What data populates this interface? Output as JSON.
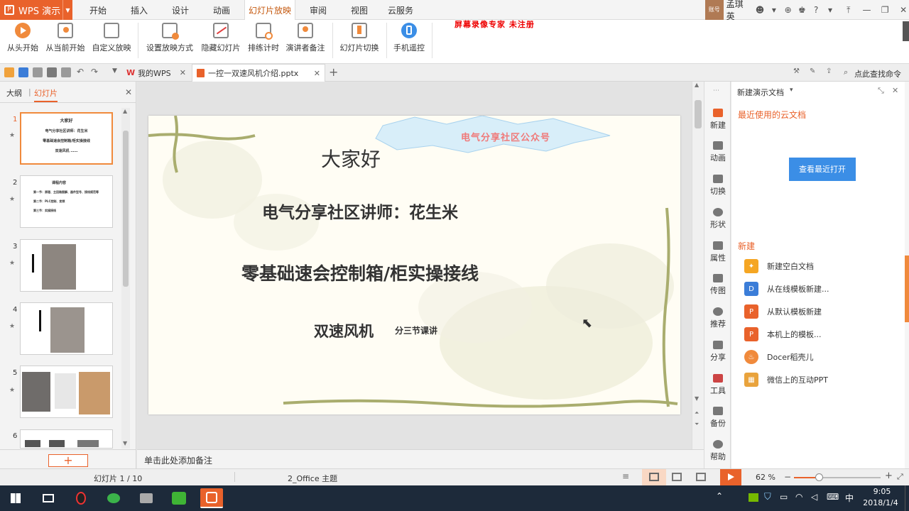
{
  "app": {
    "name": "WPS 演示",
    "watermark": "屏幕录像专家  未注册"
  },
  "menu": [
    "开始",
    "插入",
    "设计",
    "动画",
    "幻灯片放映",
    "审阅",
    "视图",
    "云服务"
  ],
  "menu_active": "幻灯片放映",
  "user": {
    "avatar_text": "账号",
    "name": "孟琪英"
  },
  "ribbon": [
    {
      "label": "从头开始",
      "color": "#f08a3c"
    },
    {
      "label": "从当前开始",
      "color": "#f08a3c"
    },
    {
      "label": "自定义放映",
      "color": "#6a6a6a"
    },
    {
      "label": "设置放映方式",
      "color": "#6a6a6a"
    },
    {
      "label": "隐藏幻灯片",
      "color": "#6a6a6a"
    },
    {
      "label": "排练计时",
      "color": "#6a6a6a"
    },
    {
      "label": "演讲者备注",
      "color": "#6a6a6a"
    },
    {
      "label": "幻灯片切换",
      "color": "#6a6a6a"
    },
    {
      "label": "手机遥控",
      "color": "#3b8ee6"
    }
  ],
  "tabs": {
    "home": "我的WPS",
    "doc": "一控一双速风机介绍.pptx",
    "search": "点此查找命令"
  },
  "left_panel": {
    "tab_outline": "大纲",
    "tab_slides": "幻灯片"
  },
  "thumb1": {
    "title": "大家好",
    "line1": "电气分享社区讲师：花生米",
    "line2": "零基础速会控制箱/柜实操接线",
    "line3": "双速风机 ……"
  },
  "thumb2": {
    "title": "课程内容",
    "line1": "第一节：原理、主回路图解、器件型号、接线规范等",
    "line2": "第二节：PLC控制、变频",
    "line3": "第三节：实操接线"
  },
  "slides": [
    1,
    2,
    3,
    4,
    5,
    6
  ],
  "slide": {
    "badge": "电气分享社区公众号",
    "greeting": "大家好",
    "lecturer": "电气分享社区讲师：花生米",
    "course": "零基础速会控制箱/柜实操接线",
    "topic": "双速风机",
    "topic_sub": "分三节课讲"
  },
  "notes_placeholder": "单击此处添加备注",
  "rightbar": [
    "新建",
    "动画",
    "切换",
    "形状",
    "属性",
    "传图",
    "推荐",
    "分享",
    "工具",
    "备份",
    "帮助"
  ],
  "task_pane": {
    "title": "新建演示文档",
    "recent_header": "最近使用的云文档",
    "view_recent_button": "查看最近打开",
    "new_header": "新建",
    "items": [
      {
        "label": "新建空白文档",
        "icon": "blank-doc-icon",
        "color": "#f5a623"
      },
      {
        "label": "从在线模板新建...",
        "icon": "online-template-icon",
        "color": "#3b7dd8"
      },
      {
        "label": "从默认模板新建",
        "icon": "default-template-icon",
        "color": "#e9622b"
      },
      {
        "label": "本机上的模板...",
        "icon": "local-template-icon",
        "color": "#e9622b"
      },
      {
        "label": "Docer稻壳儿",
        "icon": "docer-icon",
        "color": "#f08a3c"
      },
      {
        "label": "微信上的互动PPT",
        "icon": "wechat-ppt-icon",
        "color": "#e9a33c"
      }
    ]
  },
  "status": {
    "slide_counter": "幻灯片 1 / 10",
    "theme": "2_Office 主题",
    "zoom": "62 %"
  },
  "taskbar": {
    "time": "9:05",
    "date": "2018/1/4",
    "ime": "中"
  }
}
